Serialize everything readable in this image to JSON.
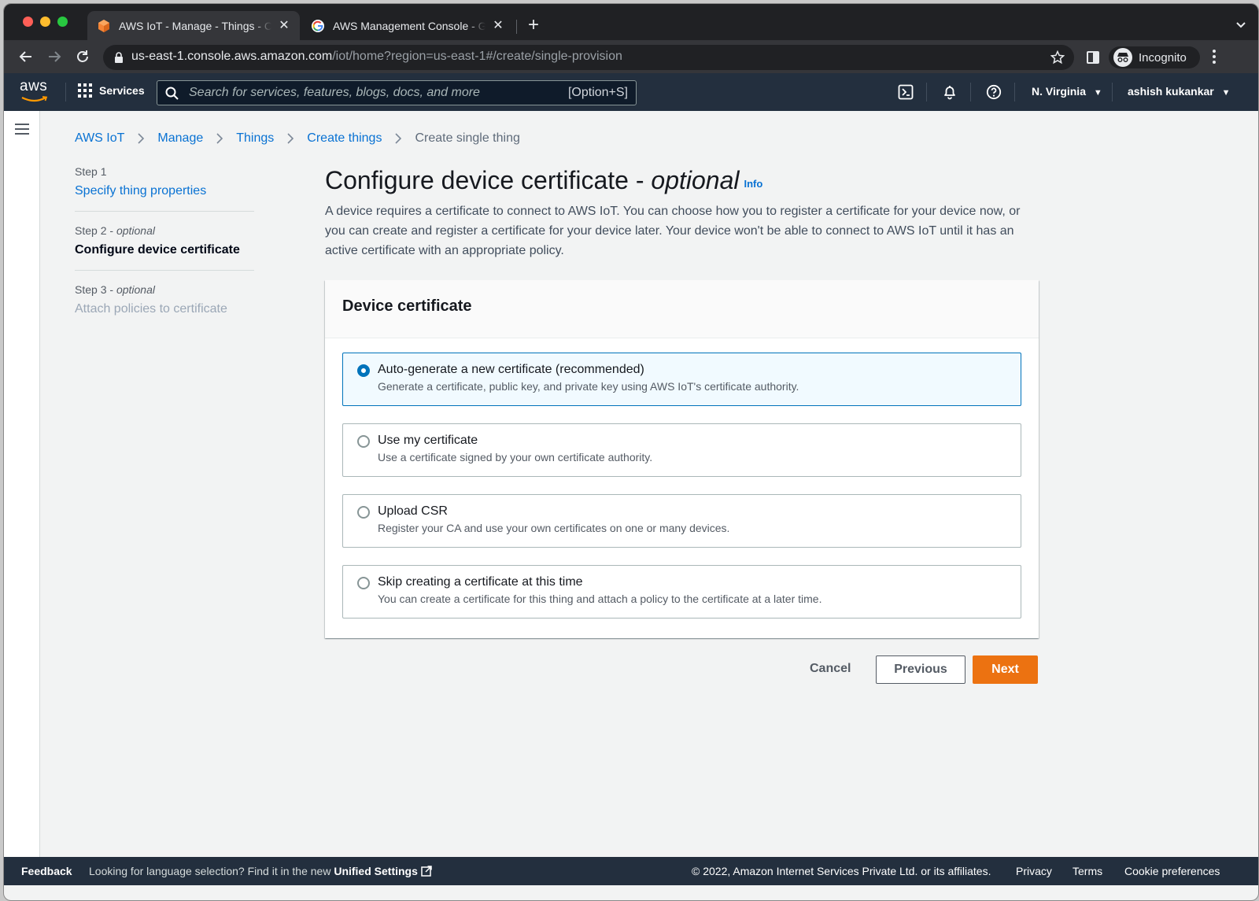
{
  "browser": {
    "tabs": [
      {
        "title": "AWS IoT - Manage - Things - C",
        "active": true
      },
      {
        "title": "AWS Management Console - G",
        "active": false
      }
    ],
    "url_host": "us-east-1.console.aws.amazon.com",
    "url_path": "/iot/home?region=us-east-1#/create/single-provision",
    "profile_label": "Incognito"
  },
  "awsnav": {
    "logo_text": "aws",
    "services_label": "Services",
    "search_placeholder": "Search for services, features, blogs, docs, and more",
    "search_shortcut": "[Option+S]",
    "region": "N. Virginia",
    "user": "ashish kukankar"
  },
  "breadcrumb": [
    "AWS IoT",
    "Manage",
    "Things",
    "Create things",
    "Create single thing"
  ],
  "steps": [
    {
      "number": "Step 1",
      "qualifier": "",
      "title": "Specify thing properties",
      "state": "link"
    },
    {
      "number": "Step 2",
      "qualifier": "optional",
      "title": "Configure device certificate",
      "state": "current"
    },
    {
      "number": "Step 3",
      "qualifier": "optional",
      "title": "Attach policies to certificate",
      "state": "disabled"
    }
  ],
  "page": {
    "title": "Configure device certificate - ",
    "title_optional": "optional",
    "info_label": "Info",
    "description": "A device requires a certificate to connect to AWS IoT. You can choose how you to register a certificate for your device now, or you can create and register a certificate for your device later. Your device won't be able to connect to AWS IoT until it has an active certificate with an appropriate policy."
  },
  "panel": {
    "heading": "Device certificate",
    "options": [
      {
        "label": "Auto-generate a new certificate (recommended)",
        "description": "Generate a certificate, public key, and private key using AWS IoT's certificate authority.",
        "selected": true
      },
      {
        "label": "Use my certificate",
        "description": "Use a certificate signed by your own certificate authority.",
        "selected": false
      },
      {
        "label": "Upload CSR",
        "description": "Register your CA and use your own certificates on one or many devices.",
        "selected": false
      },
      {
        "label": "Skip creating a certificate at this time",
        "description": "You can create a certificate for this thing and attach a policy to the certificate at a later time.",
        "selected": false
      }
    ]
  },
  "actions": {
    "cancel": "Cancel",
    "previous": "Previous",
    "next": "Next"
  },
  "footer": {
    "feedback": "Feedback",
    "lang_text": "Looking for language selection? Find it in the new ",
    "lang_link": "Unified Settings",
    "copyright": "© 2022, Amazon Internet Services Private Ltd. or its affiliates.",
    "links": [
      "Privacy",
      "Terms",
      "Cookie preferences"
    ]
  },
  "colors": {
    "aws_nav": "#232f3e",
    "link": "#0972d3",
    "primary_button": "#ec7211",
    "selected_border": "#0073bb"
  }
}
